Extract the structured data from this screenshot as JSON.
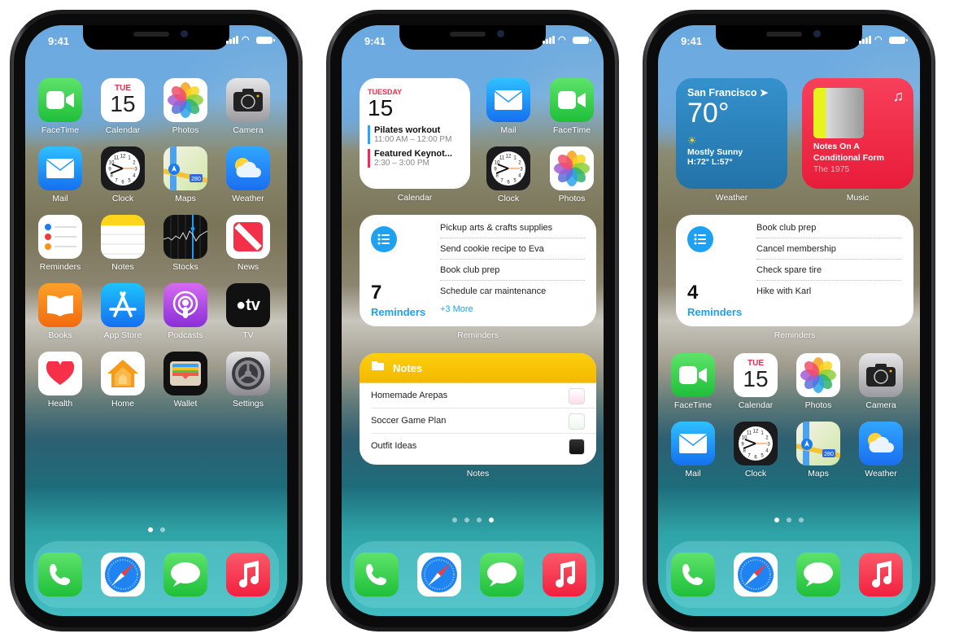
{
  "status_bar": {
    "time": "9:41"
  },
  "phones": [
    {
      "name": "home-page-1",
      "apps": [
        {
          "label": "FaceTime",
          "icon": "facetime-icon"
        },
        {
          "label": "Calendar",
          "icon": "calendar-icon",
          "day": "TUE",
          "date": "15"
        },
        {
          "label": "Photos",
          "icon": "photos-icon"
        },
        {
          "label": "Camera",
          "icon": "camera-icon"
        },
        {
          "label": "Mail",
          "icon": "mail-icon"
        },
        {
          "label": "Clock",
          "icon": "clock-icon"
        },
        {
          "label": "Maps",
          "icon": "maps-icon",
          "badge": "280"
        },
        {
          "label": "Weather",
          "icon": "weather-icon"
        },
        {
          "label": "Reminders",
          "icon": "reminders-icon"
        },
        {
          "label": "Notes",
          "icon": "notes-icon"
        },
        {
          "label": "Stocks",
          "icon": "stocks-icon"
        },
        {
          "label": "News",
          "icon": "news-icon"
        },
        {
          "label": "Books",
          "icon": "books-icon"
        },
        {
          "label": "App Store",
          "icon": "app-store-icon"
        },
        {
          "label": "Podcasts",
          "icon": "podcasts-icon"
        },
        {
          "label": "TV",
          "icon": "tv-icon",
          "glyph": "tv"
        },
        {
          "label": "Health",
          "icon": "health-icon"
        },
        {
          "label": "Home",
          "icon": "home-icon"
        },
        {
          "label": "Wallet",
          "icon": "wallet-icon"
        },
        {
          "label": "Settings",
          "icon": "settings-icon"
        }
      ],
      "page_dots": {
        "count": 2,
        "active": 1
      }
    },
    {
      "name": "home-page-2",
      "calendar_widget": {
        "day": "TUESDAY",
        "date": "15",
        "events": [
          {
            "title": "Pilates workout",
            "time": "11:00 AM – 12:00 PM",
            "color": "#2aa4f4"
          },
          {
            "title": "Featured Keynot...",
            "time": "2:30 – 3:00 PM",
            "color": "#f2295b"
          }
        ],
        "label": "Calendar"
      },
      "apps": [
        {
          "label": "Mail",
          "icon": "mail-icon"
        },
        {
          "label": "FaceTime",
          "icon": "facetime-icon"
        },
        {
          "label": "Clock",
          "icon": "clock-icon"
        },
        {
          "label": "Photos",
          "icon": "photos-icon"
        }
      ],
      "reminders_widget": {
        "count": "7",
        "title": "Reminders",
        "items": [
          "Pickup arts & crafts supplies",
          "Send cookie recipe to Eva",
          "Book club prep",
          "Schedule car maintenance"
        ],
        "more": "+3 More",
        "label": "Reminders"
      },
      "notes_widget": {
        "title": "Notes",
        "items": [
          "Homemade Arepas",
          "Soccer Game Plan",
          "Outfit Ideas"
        ],
        "label": "Notes"
      },
      "page_dots": {
        "count": 4,
        "active": 4
      }
    },
    {
      "name": "home-page-3",
      "weather_widget": {
        "city": "San Francisco",
        "temp": "70°",
        "condition": "Mostly Sunny",
        "hilo": "H:72° L:57°",
        "label": "Weather"
      },
      "music_widget": {
        "title_line1": "Notes On A",
        "title_line2": "Conditional Form",
        "artist": "The 1975",
        "label": "Music"
      },
      "reminders_widget": {
        "count": "4",
        "title": "Reminders",
        "items": [
          "Book club prep",
          "Cancel membership",
          "Check spare tire",
          "Hike with Karl"
        ],
        "label": "Reminders"
      },
      "apps": [
        {
          "label": "FaceTime",
          "icon": "facetime-icon"
        },
        {
          "label": "Calendar",
          "icon": "calendar-icon",
          "day": "TUE",
          "date": "15"
        },
        {
          "label": "Photos",
          "icon": "photos-icon"
        },
        {
          "label": "Camera",
          "icon": "camera-icon"
        },
        {
          "label": "Mail",
          "icon": "mail-icon"
        },
        {
          "label": "Clock",
          "icon": "clock-icon"
        },
        {
          "label": "Maps",
          "icon": "maps-icon",
          "badge": "280"
        },
        {
          "label": "Weather",
          "icon": "weather-icon"
        }
      ],
      "page_dots": {
        "count": 3,
        "active": 1
      }
    }
  ],
  "dock": [
    {
      "name": "Phone",
      "icon": "phone-icon"
    },
    {
      "name": "Safari",
      "icon": "safari-icon"
    },
    {
      "name": "Messages",
      "icon": "messages-icon"
    },
    {
      "name": "Music",
      "icon": "music-icon"
    }
  ],
  "colors": {
    "reminders_blue": "#1ea1f2",
    "notes_yellow": "#f7c200",
    "weather_blue": "#2d86c0",
    "music_red": "#f2304a",
    "calendar_red": "#f2294b"
  }
}
